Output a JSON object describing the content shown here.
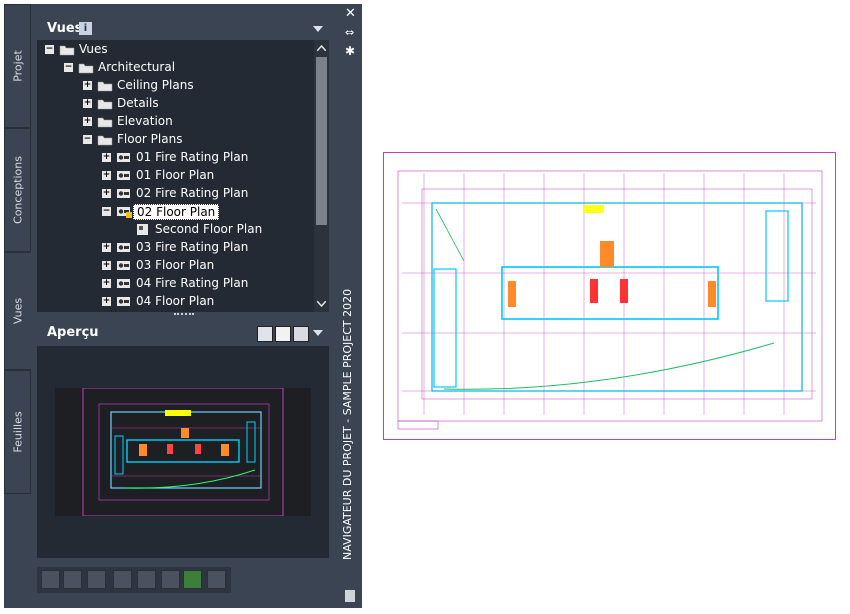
{
  "side_tabs": [
    "Projet",
    "Conceptions",
    "Vues",
    "Feuilles"
  ],
  "views_panel": {
    "title": "Vues",
    "info_badge": "i"
  },
  "tree": [
    {
      "label": "Vues",
      "level": 0,
      "expander": "−",
      "icon": "folder-open-icon"
    },
    {
      "label": "Architectural",
      "level": 1,
      "expander": "−",
      "icon": "folder-open-icon"
    },
    {
      "label": "Ceiling Plans",
      "level": 2,
      "expander": "+",
      "icon": "folder-icon"
    },
    {
      "label": "Details",
      "level": 2,
      "expander": "+",
      "icon": "folder-icon"
    },
    {
      "label": "Elevation",
      "level": 2,
      "expander": "+",
      "icon": "folder-icon"
    },
    {
      "label": "Floor Plans",
      "level": 2,
      "expander": "−",
      "icon": "folder-open-icon"
    },
    {
      "label": "01 Fire Rating Plan",
      "level": 3,
      "expander": "+",
      "icon": "view-icon"
    },
    {
      "label": "01 Floor Plan",
      "level": 3,
      "expander": "+",
      "icon": "view-icon"
    },
    {
      "label": "02 Fire Rating Plan",
      "level": 3,
      "expander": "+",
      "icon": "view-icon"
    },
    {
      "label": "02 Floor Plan",
      "level": 3,
      "expander": "−",
      "icon": "view-locked-icon",
      "selected": true
    },
    {
      "label": "Second Floor Plan",
      "level": 4,
      "expander": "",
      "icon": "viewport-icon"
    },
    {
      "label": "03 Fire Rating Plan",
      "level": 3,
      "expander": "+",
      "icon": "view-icon"
    },
    {
      "label": "03 Floor Plan",
      "level": 3,
      "expander": "+",
      "icon": "view-icon"
    },
    {
      "label": "04 Fire Rating Plan",
      "level": 3,
      "expander": "+",
      "icon": "view-icon"
    },
    {
      "label": "04 Floor Plan",
      "level": 3,
      "expander": "+",
      "icon": "view-icon"
    }
  ],
  "preview_panel": {
    "title": "Aperçu"
  },
  "vertical_title": "NAVIGATEUR DU PROJET - SAMPLE PROJECT 2020",
  "controls": {
    "close": "✕",
    "autohide": "⇔",
    "properties": "✱"
  },
  "colors": {
    "panel_bg": "#3b4453",
    "tree_bg": "#232a33",
    "plan_magenta": "#c040c0",
    "plan_cyan": "#00b4e6"
  }
}
